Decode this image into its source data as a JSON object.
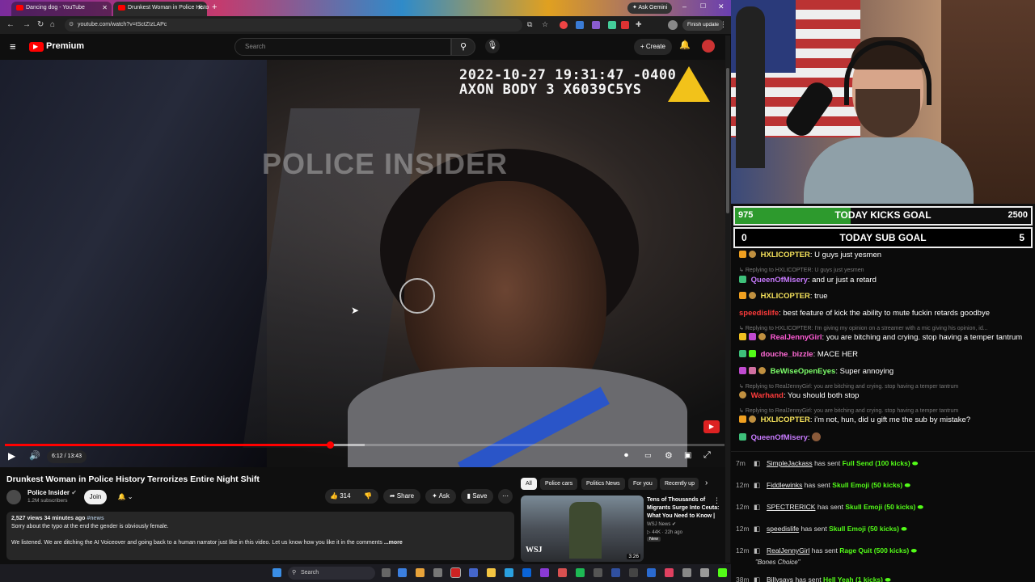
{
  "browser": {
    "tabs": [
      {
        "title": "Dancing dog - YouTube",
        "active": false
      },
      {
        "title": "Drunkest Woman in Police Histo",
        "active": true
      }
    ],
    "ask_gemini": "Ask Gemini",
    "url": "youtube.com/watch?v=tSctZIzLAPc",
    "finish_update": "Finish update"
  },
  "youtube": {
    "logo_text": "Premium",
    "search_placeholder": "Search",
    "create_label": "Create"
  },
  "video": {
    "timestamp_line1": "2022-10-27 19:31:47 -0400",
    "timestamp_line2": "AXON BODY 3 X6039C5YS",
    "watermark": "POLICE INSIDER",
    "time_display": "6:12 / 13:43",
    "progress_fraction": 0.452,
    "buffer_fraction": 0.5
  },
  "info": {
    "title": "Drunkest Woman in Police History Terrorizes Entire Night Shift",
    "channel": "Police Insider",
    "subscribers": "1.2M subscribers",
    "join_label": "Join",
    "likes": "314",
    "share_label": "Share",
    "ask_label": "Ask",
    "save_label": "Save",
    "views_meta": "2,527 views  34 minutes ago",
    "hashtag": "#news",
    "desc_line1": "Sorry about the typo at the end the gender is obviously female.",
    "desc_line2": "We listened. We are ditching the AI Voiceover and going back to a human narrator just like in this video. Let us know how you like it in the comments",
    "more": "...more"
  },
  "chips": [
    "All",
    "Police cars",
    "Politics News",
    "For you",
    "Recently up"
  ],
  "recommended": {
    "title": "Tens of Thousands of Migrants Surge Into Ceuta: What You Need to Know |",
    "channel": "WSJ News",
    "meta": "44K · 22h ago",
    "badge": "New",
    "duration": "3:26",
    "thumb_logo": "WSJ"
  },
  "taskbar": {
    "search": "Search"
  },
  "goals": {
    "kicks": {
      "current": "975",
      "label": "TODAY KICKS GOAL",
      "target": "2500",
      "progress_fraction": 0.39
    },
    "subs": {
      "current": "0",
      "label": "TODAY SUB GOAL",
      "target": "5"
    }
  },
  "chat": {
    "messages": [
      {
        "user": "HXLICOPTER",
        "text": "U guys just yesmen",
        "reply": ""
      },
      {
        "user": "QueenOfMisery",
        "text": "and ur just a retard",
        "reply": "Replying to HXLICOPTER: U guys just yesmen"
      },
      {
        "user": "HXLICOPTER",
        "text": "true",
        "reply": ""
      },
      {
        "user": "speedislife",
        "text": "best feature of kick the ability to mute fuckin retards goodbye",
        "reply": ""
      },
      {
        "user": "RealJennyGirl",
        "text": "you are bitching and crying. stop having a temper tantrum",
        "reply": "Replying to HXLICOPTER: I'm giving my opinion on a streamer with a mic giving his opinion, id..."
      },
      {
        "user": "douche_bizzle",
        "text": "MACE HER",
        "reply": ""
      },
      {
        "user": "BeWiseOpenEyes",
        "text": "Super annoying",
        "reply": ""
      },
      {
        "user": "Warhand",
        "text": "You should both stop",
        "reply": "Replying to RealJennyGirl: you are bitching and crying. stop having a temper tantrum"
      },
      {
        "user": "HXLICOPTER",
        "text": "i'm not, hun, did u gift me the sub by mistake?",
        "reply": "Replying to RealJennyGirl: you are bitching and crying. stop having a temper tantrum"
      },
      {
        "user": "QueenOfMisery",
        "text": "",
        "reply": ""
      }
    ],
    "events": [
      {
        "ago": "7m",
        "user": "SimpleJackass",
        "action": "has sent",
        "gift": "Full Send (100 kicks)"
      },
      {
        "ago": "12m",
        "user": "Fiddlewinks",
        "action": "has sent",
        "gift": "Skull Emoji (50 kicks)"
      },
      {
        "ago": "12m",
        "user": "SPECTRERICK",
        "action": "has sent",
        "gift": "Skull Emoji (50 kicks)"
      },
      {
        "ago": "12m",
        "user": "speedislife",
        "action": "has sent",
        "gift": "Skull Emoji (50 kicks)"
      },
      {
        "ago": "12m",
        "user": "RealJennyGirl",
        "action": "has sent",
        "gift": "Rage Quit (500 kicks)",
        "note": "\"Bones Choice\""
      },
      {
        "ago": "38m",
        "user": "Billysays",
        "action": "has sent",
        "gift": "Hell Yeah (1 kicks)"
      }
    ]
  },
  "colors": {
    "kick_green": "#53fc18",
    "yt_red": "#ff0000",
    "hxlicopter": "#f5e25b",
    "queen": "#c87bff",
    "speed": "#ff3b3b",
    "jenny": "#ff5bd6",
    "douche": "#ff6ad5",
    "bewise": "#7dff6a",
    "warhand": "#ff3b3b"
  }
}
